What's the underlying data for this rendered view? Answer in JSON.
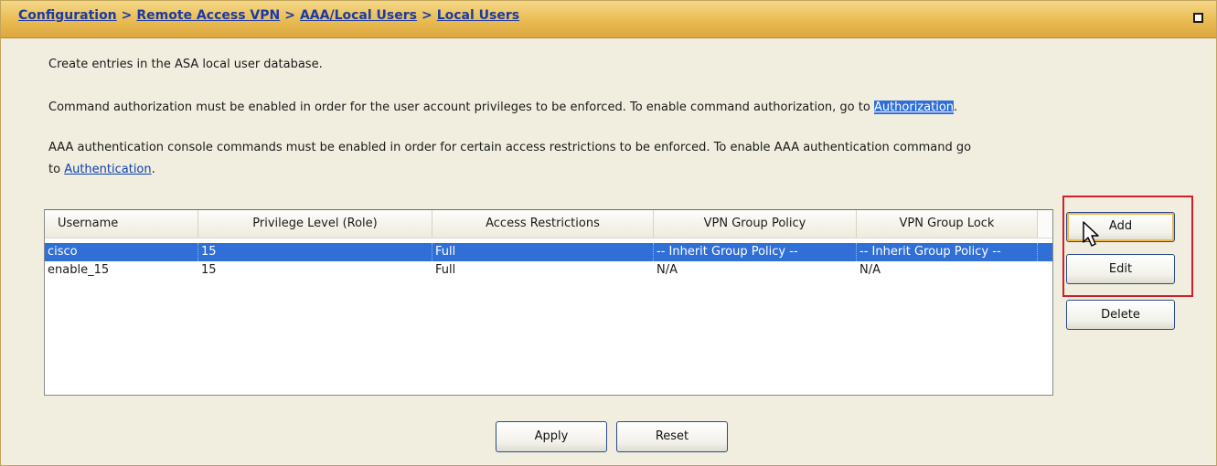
{
  "breadcrumb": [
    "Configuration",
    "Remote Access VPN",
    "AAA/Local Users",
    "Local Users"
  ],
  "breadcrumb_separator": ">",
  "description": {
    "line1": "Create entries in the ASA local user database.",
    "line2_text": "Command authorization must be enabled in order for the user account privileges to be enforced. To enable command authorization, go to ",
    "line2_link": "Authorization",
    "line2_end": ".",
    "line3a": "AAA authentication console commands must be enabled in order for certain access restrictions to be enforced. To enable AAA authentication command go",
    "line3b_prefix": "to ",
    "line3b_link": "Authentication",
    "line3b_end": "."
  },
  "table": {
    "columns": [
      "Username",
      "Privilege Level (Role)",
      "Access Restrictions",
      "VPN Group Policy",
      "VPN Group Lock"
    ],
    "rows": [
      [
        "cisco",
        "15",
        "Full",
        "-- Inherit Group Policy --",
        "-- Inherit Group Policy --"
      ],
      [
        "enable_15",
        "15",
        "Full",
        "N/A",
        "N/A"
      ]
    ],
    "selected_row": 0
  },
  "side_buttons": {
    "add": "Add",
    "edit": "Edit",
    "delete": "Delete"
  },
  "footer_buttons": {
    "apply": "Apply",
    "reset": "Reset"
  },
  "icons": {
    "maximize": "maximize-icon",
    "cursor": "mouse-pointer-icon"
  },
  "colors": {
    "title_bar": "#e9bb52",
    "panel_bg": "#f1eedf",
    "link": "#0b3fb0",
    "selection": "#2f6fd6",
    "highlight_box": "#d2202a"
  }
}
